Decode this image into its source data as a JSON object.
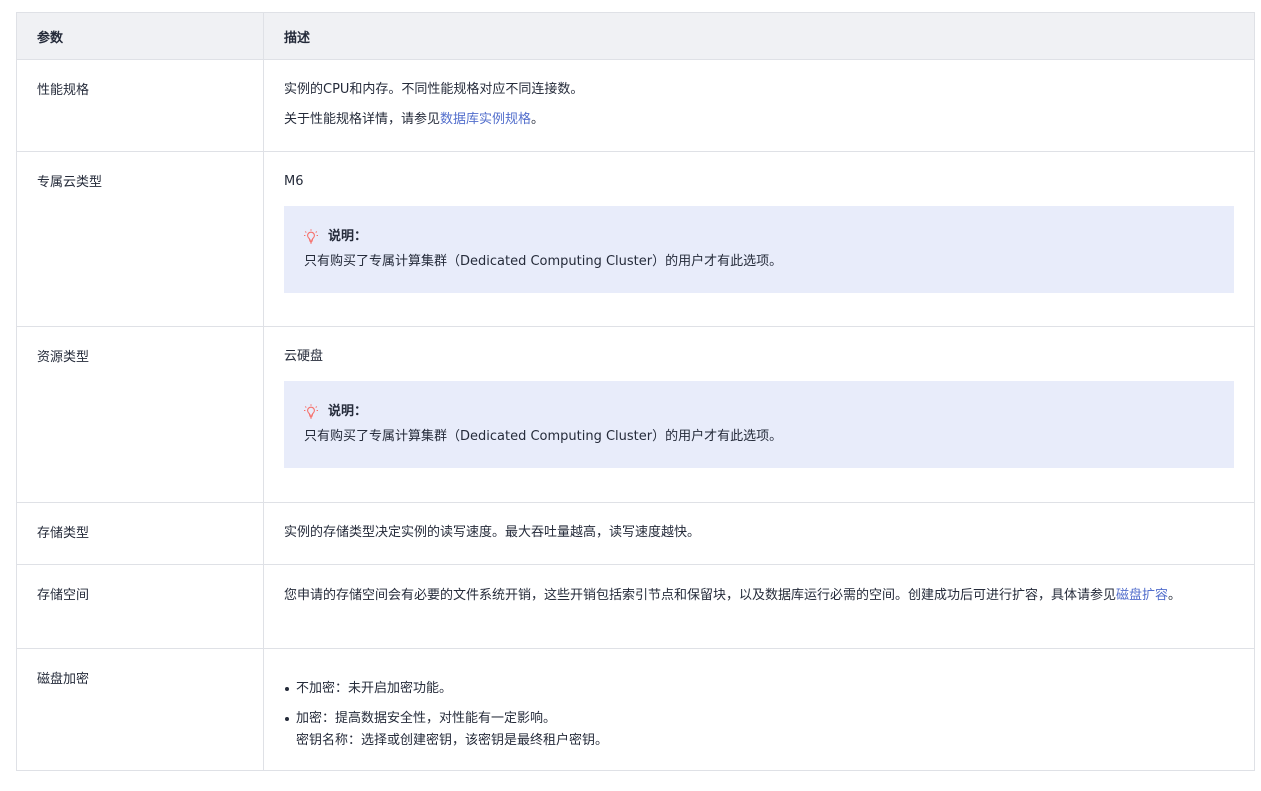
{
  "table": {
    "headers": {
      "param": "参数",
      "desc": "描述"
    },
    "rows": {
      "perf": {
        "param": "性能规格",
        "line1": "实例的CPU和内存。不同性能规格对应不同连接数。",
        "line2_prefix": "关于性能规格详情，请参见",
        "line2_link": "数据库实例规格",
        "line2_suffix": "。"
      },
      "dcc": {
        "param": "专属云类型",
        "value": "M6",
        "note_title": "说明：",
        "note_text": "只有购买了专属计算集群（Dedicated Computing Cluster）的用户才有此选项。"
      },
      "res": {
        "param": "资源类型",
        "value": "云硬盘",
        "note_title": "说明：",
        "note_text": "只有购买了专属计算集群（Dedicated Computing Cluster）的用户才有此选项。"
      },
      "stype": {
        "param": "存储类型",
        "text": "实例的存储类型决定实例的读写速度。最大吞吐量越高，读写速度越快。"
      },
      "space": {
        "param": "存储空间",
        "text_prefix": "您申请的存储空间会有必要的文件系统开销，这些开销包括索引节点和保留块，以及数据库运行必需的空间。创建成功后可进行扩容，具体请参见",
        "link": "磁盘扩容",
        "text_suffix": "。"
      },
      "enc": {
        "param": "磁盘加密",
        "item1": "不加密：未开启加密功能。",
        "item2": "加密：提高数据安全性，对性能有一定影响。",
        "item2_sub": "密钥名称：选择或创建密钥，该密钥是最终租户密钥。"
      }
    }
  },
  "colors": {
    "header_bg": "#f0f1f4",
    "border": "#dfe1e6",
    "note_bg": "#e8ecfa",
    "link": "#526ecc",
    "note_icon": "#f66f6a"
  },
  "icons": {
    "note": "lightbulb-icon"
  }
}
